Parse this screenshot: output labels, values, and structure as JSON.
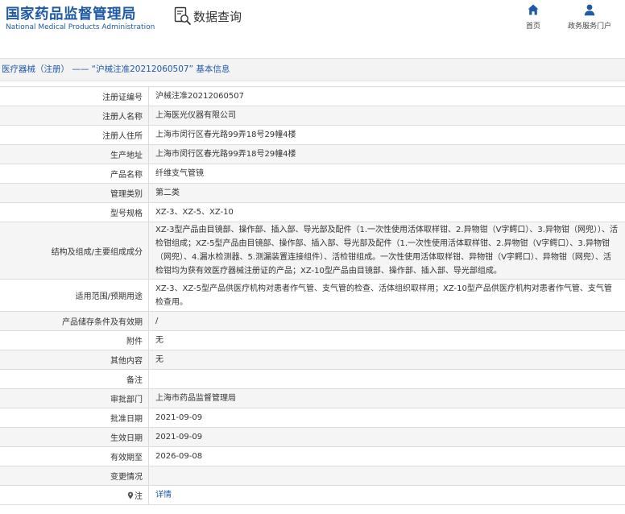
{
  "header": {
    "agency_cn": "国家药品监督管理局",
    "agency_en": "National Medical Products Administration",
    "section_title": "数据查询",
    "nav": [
      {
        "label": "首页",
        "icon": "home-icon"
      },
      {
        "label": "政务服务门户",
        "icon": "user-icon"
      }
    ]
  },
  "breadcrumb": "医疗器械（注册） —— “沪械注准20212060507” 基本信息",
  "rows": [
    {
      "label": "注册证编号",
      "value": "沪械注准20212060507"
    },
    {
      "label": "注册人名称",
      "value": "上海医光仪器有限公司"
    },
    {
      "label": "注册人住所",
      "value": "上海市闵行区春光路99弄18号29幢4楼"
    },
    {
      "label": "生产地址",
      "value": "上海市闵行区春光路99弄18号29幢4楼"
    },
    {
      "label": "产品名称",
      "value": "纤维支气管镜"
    },
    {
      "label": "管理类别",
      "value": "第二类"
    },
    {
      "label": "型号规格",
      "value": "XZ-3、XZ-5、XZ-10"
    },
    {
      "label": "结构及组成/主要组成成分",
      "value": "XZ-3型产品由目镜部、操作部、插入部、导光部及配件（1.一次性使用活体取样钳、2.异物钳（V字鳄口）、3.异物钳（网兜））、活检钳组成；XZ-5型产品由目镜部、操作部、插入部、导光部及配件（1.一次性使用活体取样钳、2.异物钳（V字鳄口）、3.异物钳（网兜）、4.漏水检测器、5.测漏装置连接组件）、活检钳组成。一次性使用活体取样钳、异物钳（V字鳄口）、异物钳（网兜）、活检钳均为获有效医疗器械注册证的产品；XZ-10型产品由目镜部、操作部、插入部、导光部组成。"
    },
    {
      "label": "适用范围/预期用途",
      "value": "XZ-3、XZ-5型产品供医疗机构对患者作气管、支气管的检查、活体组织取样用；XZ-10型产品供医疗机构对患者作气管、支气管检查用。"
    },
    {
      "label": "产品储存条件及有效期",
      "value": "/"
    },
    {
      "label": "附件",
      "value": "无"
    },
    {
      "label": "其他内容",
      "value": "无"
    },
    {
      "label": "备注",
      "value": ""
    },
    {
      "label": "审批部门",
      "value": "上海市药品监督管理局"
    },
    {
      "label": "批准日期",
      "value": "2021-09-09"
    },
    {
      "label": "生效日期",
      "value": "2021-09-09"
    },
    {
      "label": "有效期至",
      "value": "2026-09-08"
    },
    {
      "label": "变更情况",
      "value": ""
    },
    {
      "label": "注",
      "value": "详情"
    }
  ],
  "colors": {
    "brand_blue": "#1f5aa6",
    "border": "#dcdcdc",
    "alt_row": "#f5f5f5"
  }
}
